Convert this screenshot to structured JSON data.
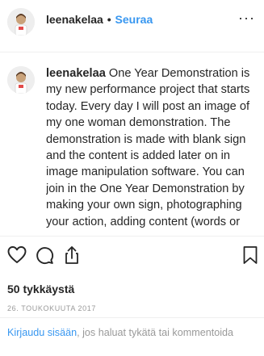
{
  "post_header": {
    "username": "leenakelaa",
    "separator": "•",
    "follow_label": "Seuraa",
    "more_label": "···"
  },
  "caption": {
    "username": "leenakelaa",
    "text": "One Year Demonstration is my new performance project that starts today. Every day I will post an image of my one woman demonstration. The demonstration is made with blank sign and the content is added later on in image manipulation software. You can join in the One Year Demonstration by making your own sign, photographing your action, adding content (words or pictures) and tagging your image"
  },
  "actions": {
    "icons": [
      "heart-icon",
      "comment-icon",
      "share-icon",
      "bookmark-icon"
    ]
  },
  "likes": "50 tykkäystä",
  "date": "26. TOUKOKUUTA 2017",
  "login_prompt": {
    "link": "Kirjaudu sisään",
    "rest": ", jos haluat tykätä tai kommentoida"
  },
  "colors": {
    "link": "#3897f0",
    "text": "#262626",
    "muted": "#999999"
  }
}
